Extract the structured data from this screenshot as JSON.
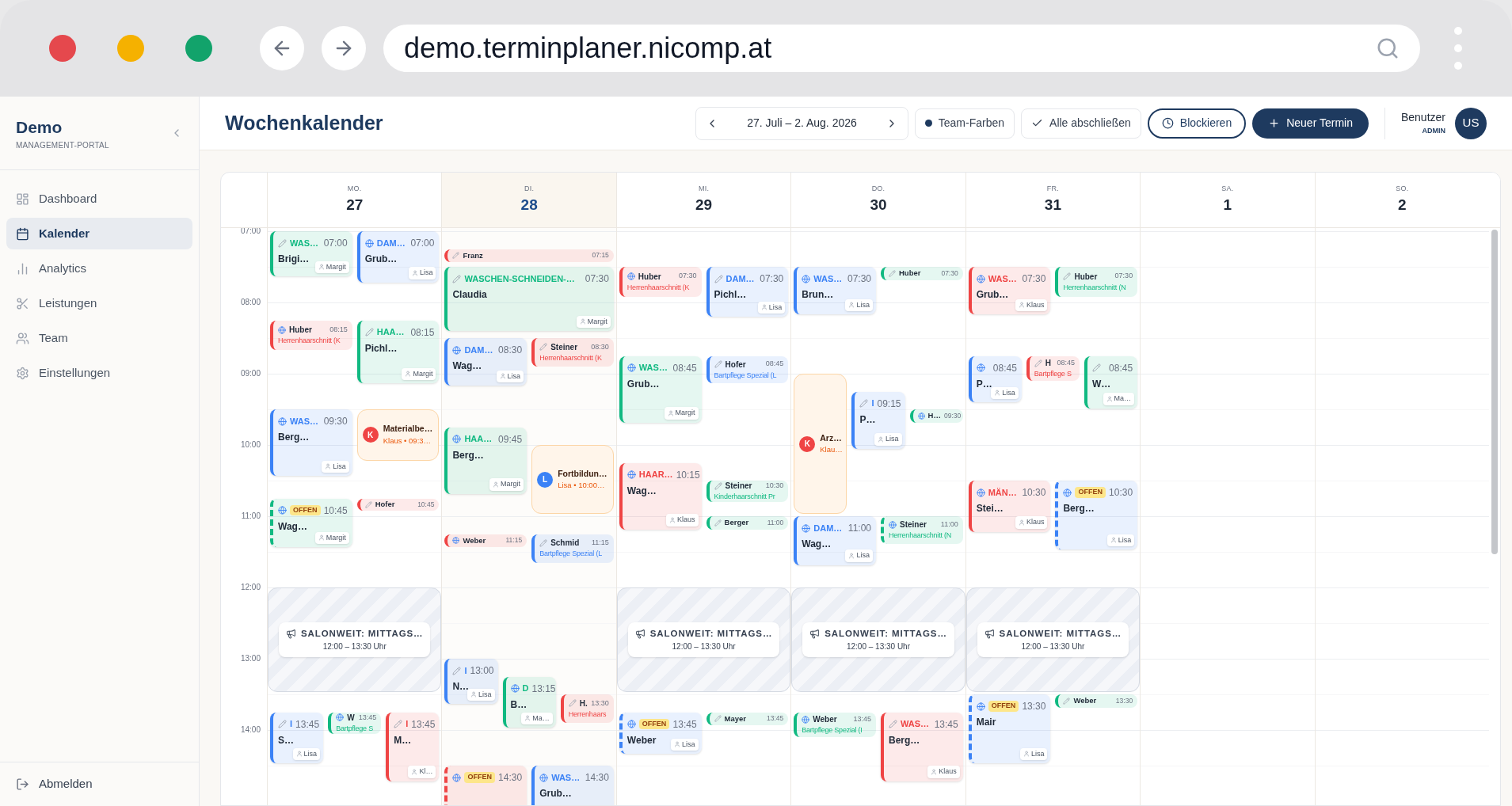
{
  "browser": {
    "url": "demo.terminplaner.nicomp.at"
  },
  "sidebar": {
    "title": "Demo",
    "subtitle": "MANAGEMENT-PORTAL",
    "items": [
      {
        "label": "Dashboard",
        "selected": false
      },
      {
        "label": "Kalender",
        "selected": true
      },
      {
        "label": "Analytics",
        "selected": false
      },
      {
        "label": "Leistungen",
        "selected": false
      },
      {
        "label": "Team",
        "selected": false
      },
      {
        "label": "Einstellungen",
        "selected": false
      }
    ],
    "logout": "Abmelden"
  },
  "topbar": {
    "title": "Wochenkalender",
    "range": "27. Juli – 2. Aug. 2026",
    "team_colors": "Team-Farben",
    "close_all": "Alle abschließen",
    "block": "Blockieren",
    "new": "Neuer Termin",
    "user": "Benutzer",
    "role": "ADMIN",
    "initials": "US"
  },
  "hours": [
    "07:00",
    "08:00",
    "09:00",
    "10:00",
    "11:00",
    "12:00",
    "13:00",
    "14:00"
  ],
  "days": [
    {
      "abbr": "MO.",
      "date": "27",
      "today": false,
      "events": [
        {
          "kind": "card",
          "online": false,
          "color": "#10b981",
          "service": "WAS…",
          "time": "07:00",
          "client": "Brigi…",
          "staff": "Margit",
          "open": false
        },
        {
          "kind": "card",
          "online": true,
          "color": "#3b82f6",
          "service": "DAM…",
          "time": "07:00",
          "client": "Grub…",
          "staff": "Lisa",
          "open": false
        },
        {
          "kind": "compact",
          "online": true,
          "color": "#ef4444",
          "client": "Huber",
          "time": "08:15",
          "service": "Herrenhaarschnitt (K",
          "open": false
        },
        {
          "kind": "card",
          "online": false,
          "color": "#10b981",
          "service": "HAA…",
          "time": "08:15",
          "client": "Pichl…",
          "staff": "Margit",
          "open": false
        },
        {
          "kind": "card",
          "online": true,
          "color": "#3b82f6",
          "service": "WAS…",
          "time": "09:30",
          "client": "Berg…",
          "staff": "Lisa",
          "open": false
        },
        {
          "kind": "block",
          "color": "#ef4444",
          "avatar": "K",
          "title": "Materialbe…",
          "subtitle": "Klaus • 09:3…"
        },
        {
          "kind": "card",
          "online": true,
          "color": "#10b981",
          "badge": "OFFEN",
          "time": "10:45",
          "client": "Wag…",
          "staff": "Margit",
          "open": true
        },
        {
          "kind": "mini",
          "online": false,
          "color": "#ef4444",
          "client": "Hofer",
          "time": "10:45",
          "open": false
        },
        {
          "kind": "closure",
          "title": "SALONWEIT: MITTAGS…",
          "subtitle": "12:00 – 13:30 Uhr"
        },
        {
          "kind": "card",
          "online": false,
          "color": "#3b82f6",
          "service": "I",
          "time": "13:45",
          "client": "S…",
          "staff": "Lisa",
          "open": false
        },
        {
          "kind": "compact",
          "online": true,
          "color": "#10b981",
          "client": "W",
          "time": "13:45",
          "service": "Bartpflege S",
          "open": false
        },
        {
          "kind": "card",
          "online": false,
          "color": "#ef4444",
          "service": "I",
          "time": "13:45",
          "client": "M…",
          "staff": "Kl…",
          "open": false
        }
      ]
    },
    {
      "abbr": "DI.",
      "date": "28",
      "today": true,
      "events": [
        {
          "kind": "mini",
          "online": false,
          "color": "#ef4444",
          "client": "Franz",
          "time": "07:15",
          "open": false
        },
        {
          "kind": "card",
          "online": false,
          "color": "#10b981",
          "service": "WASCHEN-SCHNEIDEN-…",
          "time": "07:30",
          "client": "Claudia",
          "staff": "Margit",
          "open": false
        },
        {
          "kind": "card",
          "online": true,
          "color": "#3b82f6",
          "service": "DAM…",
          "time": "08:30",
          "client": "Wag…",
          "staff": "Lisa",
          "open": false
        },
        {
          "kind": "compact",
          "online": false,
          "color": "#ef4444",
          "client": "Steiner",
          "time": "08:30",
          "service": "Herrenhaarschnitt (K",
          "open": false
        },
        {
          "kind": "card",
          "online": true,
          "color": "#10b981",
          "service": "HAA…",
          "time": "09:45",
          "client": "Berg…",
          "staff": "Margit",
          "open": false
        },
        {
          "kind": "block",
          "color": "#3b82f6",
          "avatar": "L",
          "title": "Fortbildun…",
          "subtitle": "Lisa • 10:00…"
        },
        {
          "kind": "mini",
          "online": true,
          "color": "#ef4444",
          "client": "Weber",
          "time": "11:15",
          "open": false
        },
        {
          "kind": "compact",
          "online": false,
          "color": "#3b82f6",
          "client": "Schmid",
          "time": "11:15",
          "service": "Bartpflege Spezial (L",
          "open": false
        },
        {
          "kind": "card",
          "online": false,
          "color": "#3b82f6",
          "service": "I",
          "time": "13:00",
          "client": "N…",
          "staff": "Lisa",
          "open": false
        },
        {
          "kind": "card",
          "online": true,
          "color": "#10b981",
          "service": "D",
          "time": "13:15",
          "client": "B…",
          "staff": "Ma…",
          "open": false
        },
        {
          "kind": "compact",
          "online": false,
          "color": "#ef4444",
          "client": "H.",
          "time": "13:30",
          "service": "Herrenhaars",
          "open": false
        },
        {
          "kind": "card",
          "online": true,
          "color": "#ef4444",
          "badge": "OFFEN",
          "time": "14:30",
          "open": true
        },
        {
          "kind": "card",
          "online": true,
          "color": "#3b82f6",
          "service": "WAS…",
          "time": "14:30",
          "client": "Grub…",
          "open": false
        }
      ]
    },
    {
      "abbr": "MI.",
      "date": "29",
      "today": false,
      "events": [
        {
          "kind": "compact",
          "online": true,
          "color": "#ef4444",
          "client": "Huber",
          "time": "07:30",
          "service": "Herrenhaarschnitt (K",
          "open": false
        },
        {
          "kind": "card",
          "online": false,
          "color": "#3b82f6",
          "service": "DAM…",
          "time": "07:30",
          "client": "Pichl…",
          "staff": "Lisa",
          "open": false
        },
        {
          "kind": "card",
          "online": true,
          "color": "#10b981",
          "service": "WAS…",
          "time": "08:45",
          "client": "Grub…",
          "staff": "Margit",
          "open": false
        },
        {
          "kind": "compact",
          "online": false,
          "color": "#3b82f6",
          "client": "Hofer",
          "time": "08:45",
          "service": "Bartpflege Spezial (L",
          "open": false
        },
        {
          "kind": "card",
          "online": true,
          "color": "#ef4444",
          "service": "HAAR…",
          "time": "10:15",
          "client": "Wag…",
          "staff": "Klaus",
          "open": false
        },
        {
          "kind": "compact",
          "online": false,
          "color": "#10b981",
          "client": "Steiner",
          "time": "10:30",
          "service": "Kinderhaarschnitt Pr",
          "open": false
        },
        {
          "kind": "mini",
          "online": false,
          "color": "#10b981",
          "client": "Berger",
          "time": "11:00",
          "open": false
        },
        {
          "kind": "closure",
          "title": "SALONWEIT: MITTAGS…",
          "subtitle": "12:00 – 13:30 Uhr"
        },
        {
          "kind": "card",
          "online": true,
          "color": "#3b82f6",
          "badge": "OFFEN",
          "time": "13:45",
          "client": "Weber",
          "staff": "Lisa",
          "open": true
        },
        {
          "kind": "mini",
          "online": false,
          "color": "#10b981",
          "client": "Mayer",
          "time": "13:45",
          "open": false
        }
      ]
    },
    {
      "abbr": "DO.",
      "date": "30",
      "today": false,
      "events": [
        {
          "kind": "card",
          "online": true,
          "color": "#3b82f6",
          "service": "WAS…",
          "time": "07:30",
          "client": "Brun…",
          "staff": "Lisa",
          "open": false
        },
        {
          "kind": "mini",
          "online": false,
          "color": "#10b981",
          "client": "Huber",
          "time": "07:30",
          "open": false
        },
        {
          "kind": "block",
          "color": "#ef4444",
          "avatar": "K",
          "title": "Arz…",
          "subtitle": "Klau…"
        },
        {
          "kind": "card",
          "online": false,
          "color": "#3b82f6",
          "service": "I",
          "time": "09:15",
          "client": "P…",
          "staff": "Lisa",
          "open": false
        },
        {
          "kind": "mini",
          "online": true,
          "color": "#10b981",
          "client": "H…",
          "time": "09:30",
          "open": false
        },
        {
          "kind": "card",
          "online": true,
          "color": "#3b82f6",
          "service": "DAM…",
          "time": "11:00",
          "client": "Wag…",
          "staff": "Lisa",
          "open": false
        },
        {
          "kind": "compact",
          "online": true,
          "color": "#10b981",
          "client": "Steiner",
          "time": "11:00",
          "service": "Herrenhaarschnitt (N",
          "open": true
        },
        {
          "kind": "closure",
          "title": "SALONWEIT: MITTAGS…",
          "subtitle": "12:00 – 13:30 Uhr"
        },
        {
          "kind": "compact",
          "online": true,
          "color": "#10b981",
          "client": "Weber",
          "time": "13:45",
          "service": "Bartpflege Spezial (I",
          "open": false
        },
        {
          "kind": "card",
          "online": false,
          "color": "#ef4444",
          "service": "WAS…",
          "time": "13:45",
          "client": "Berg…",
          "staff": "Klaus",
          "open": false
        }
      ]
    },
    {
      "abbr": "FR.",
      "date": "31",
      "today": false,
      "events": [
        {
          "kind": "card",
          "online": true,
          "color": "#ef4444",
          "service": "WAS…",
          "time": "07:30",
          "client": "Grub…",
          "staff": "Klaus",
          "open": false
        },
        {
          "kind": "compact",
          "online": false,
          "color": "#10b981",
          "client": "Huber",
          "time": "07:30",
          "service": "Herrenhaarschnitt (N",
          "open": false
        },
        {
          "kind": "card",
          "online": true,
          "color": "#3b82f6",
          "time": "08:45",
          "client": "P…",
          "staff": "Lisa",
          "open": false
        },
        {
          "kind": "compact",
          "online": false,
          "color": "#ef4444",
          "client": "H",
          "time": "08:45",
          "service": "Bartpflege S",
          "open": false
        },
        {
          "kind": "card",
          "online": false,
          "color": "#10b981",
          "time": "08:45",
          "client": "W…",
          "staff": "Ma…",
          "open": false
        },
        {
          "kind": "card",
          "online": true,
          "color": "#ef4444",
          "service": "MÄN…",
          "time": "10:30",
          "client": "Stei…",
          "staff": "Klaus",
          "open": false
        },
        {
          "kind": "card",
          "online": true,
          "color": "#3b82f6",
          "badge": "OFFEN",
          "time": "10:30",
          "client": "Berg…",
          "staff": "Lisa",
          "open": true
        },
        {
          "kind": "closure",
          "title": "SALONWEIT: MITTAGS…",
          "subtitle": "12:00 – 13:30 Uhr"
        },
        {
          "kind": "card",
          "online": true,
          "color": "#3b82f6",
          "badge": "OFFEN",
          "time": "13:30",
          "client": "Mair",
          "staff": "Lisa",
          "open": true
        },
        {
          "kind": "mini",
          "online": false,
          "color": "#10b981",
          "client": "Weber",
          "time": "13:30",
          "open": false
        }
      ]
    },
    {
      "abbr": "SA.",
      "date": "1",
      "today": false
    },
    {
      "abbr": "SO.",
      "date": "2",
      "today": false
    }
  ]
}
